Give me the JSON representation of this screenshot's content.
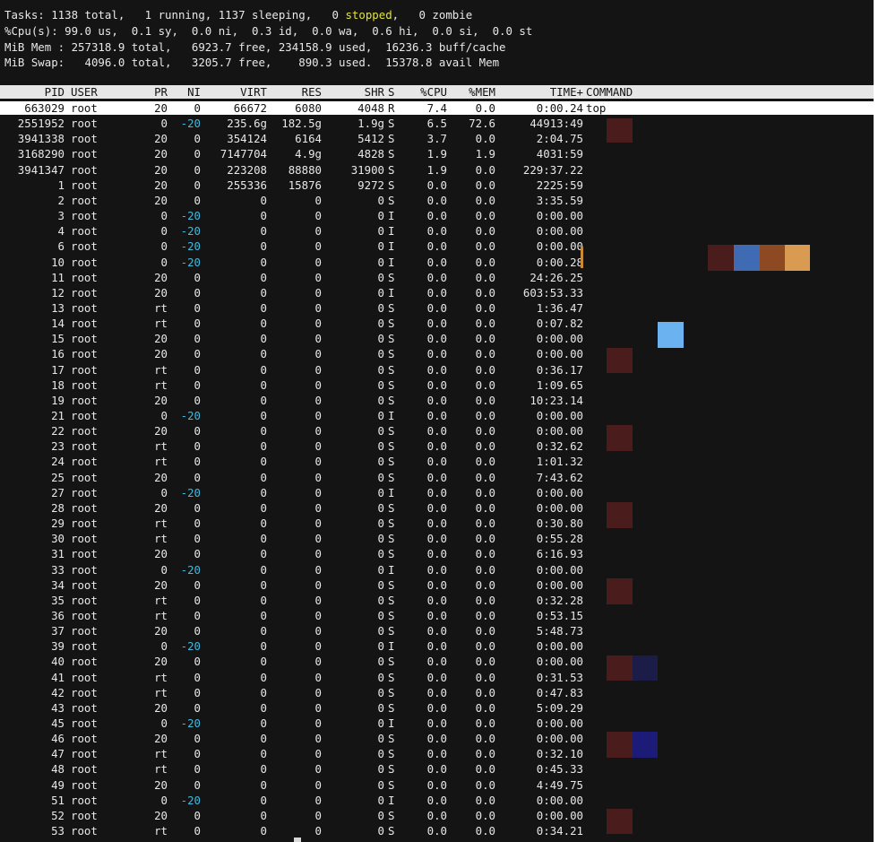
{
  "summary": {
    "tasks_a": "Tasks: 1138 total,   1 running, 1137 sleeping,   0 ",
    "tasks_b": "stopped",
    "tasks_c": ",   0 zombie",
    "cpu": "%Cpu(s): 99.0 us,  0.1 sy,  0.0 ni,  0.3 id,  0.0 wa,  0.6 hi,  0.0 si,  0.0 st",
    "mem": "MiB Mem : 257318.9 total,   6923.7 free, 234158.9 used,  16236.3 buff/cache",
    "swap": "MiB Swap:   4096.0 total,   3205.7 free,    890.3 used.  15378.8 avail Mem"
  },
  "colors": {
    "stopped": "#e3e33a",
    "nice_negative": "#46b6d9",
    "header_bg": "#e6e6e6",
    "terminal_bg": "#141414"
  },
  "columns": [
    "PID",
    "USER",
    "PR",
    "NI",
    "VIRT",
    "RES",
    "SHR",
    "S",
    "%CPU",
    "%MEM",
    "TIME+",
    "COMMAND"
  ],
  "processes": [
    [
      "663029",
      "root",
      "20",
      "0",
      "66672",
      "6080",
      "4048",
      "R",
      "7.4",
      "0.0",
      "0:00.24",
      "top"
    ],
    [
      "2551952",
      "root",
      "0",
      "-20",
      "235.6g",
      "182.5g",
      "1.9g",
      "S",
      "6.5",
      "72.6",
      "44913:49",
      ""
    ],
    [
      "3941338",
      "root",
      "20",
      "0",
      "354124",
      "6164",
      "5412",
      "S",
      "3.7",
      "0.0",
      "2:04.75",
      ""
    ],
    [
      "3168290",
      "root",
      "20",
      "0",
      "7147704",
      "4.9g",
      "4828",
      "S",
      "1.9",
      "1.9",
      "4031:59",
      ""
    ],
    [
      "3941347",
      "root",
      "20",
      "0",
      "223208",
      "88880",
      "31900",
      "S",
      "1.9",
      "0.0",
      "229:37.22",
      ""
    ],
    [
      "1",
      "root",
      "20",
      "0",
      "255336",
      "15876",
      "9272",
      "S",
      "0.0",
      "0.0",
      "2225:59",
      ""
    ],
    [
      "2",
      "root",
      "20",
      "0",
      "0",
      "0",
      "0",
      "S",
      "0.0",
      "0.0",
      "3:35.59",
      ""
    ],
    [
      "3",
      "root",
      "0",
      "-20",
      "0",
      "0",
      "0",
      "I",
      "0.0",
      "0.0",
      "0:00.00",
      ""
    ],
    [
      "4",
      "root",
      "0",
      "-20",
      "0",
      "0",
      "0",
      "I",
      "0.0",
      "0.0",
      "0:00.00",
      ""
    ],
    [
      "6",
      "root",
      "0",
      "-20",
      "0",
      "0",
      "0",
      "I",
      "0.0",
      "0.0",
      "0:00.00",
      ""
    ],
    [
      "10",
      "root",
      "0",
      "-20",
      "0",
      "0",
      "0",
      "I",
      "0.0",
      "0.0",
      "0:00.28",
      ""
    ],
    [
      "11",
      "root",
      "20",
      "0",
      "0",
      "0",
      "0",
      "S",
      "0.0",
      "0.0",
      "24:26.25",
      ""
    ],
    [
      "12",
      "root",
      "20",
      "0",
      "0",
      "0",
      "0",
      "I",
      "0.0",
      "0.0",
      "603:53.33",
      ""
    ],
    [
      "13",
      "root",
      "rt",
      "0",
      "0",
      "0",
      "0",
      "S",
      "0.0",
      "0.0",
      "1:36.47",
      ""
    ],
    [
      "14",
      "root",
      "rt",
      "0",
      "0",
      "0",
      "0",
      "S",
      "0.0",
      "0.0",
      "0:07.82",
      ""
    ],
    [
      "15",
      "root",
      "20",
      "0",
      "0",
      "0",
      "0",
      "S",
      "0.0",
      "0.0",
      "0:00.00",
      ""
    ],
    [
      "16",
      "root",
      "20",
      "0",
      "0",
      "0",
      "0",
      "S",
      "0.0",
      "0.0",
      "0:00.00",
      ""
    ],
    [
      "17",
      "root",
      "rt",
      "0",
      "0",
      "0",
      "0",
      "S",
      "0.0",
      "0.0",
      "0:36.17",
      ""
    ],
    [
      "18",
      "root",
      "rt",
      "0",
      "0",
      "0",
      "0",
      "S",
      "0.0",
      "0.0",
      "1:09.65",
      ""
    ],
    [
      "19",
      "root",
      "20",
      "0",
      "0",
      "0",
      "0",
      "S",
      "0.0",
      "0.0",
      "10:23.14",
      ""
    ],
    [
      "21",
      "root",
      "0",
      "-20",
      "0",
      "0",
      "0",
      "I",
      "0.0",
      "0.0",
      "0:00.00",
      ""
    ],
    [
      "22",
      "root",
      "20",
      "0",
      "0",
      "0",
      "0",
      "S",
      "0.0",
      "0.0",
      "0:00.00",
      ""
    ],
    [
      "23",
      "root",
      "rt",
      "0",
      "0",
      "0",
      "0",
      "S",
      "0.0",
      "0.0",
      "0:32.62",
      ""
    ],
    [
      "24",
      "root",
      "rt",
      "0",
      "0",
      "0",
      "0",
      "S",
      "0.0",
      "0.0",
      "1:01.32",
      ""
    ],
    [
      "25",
      "root",
      "20",
      "0",
      "0",
      "0",
      "0",
      "S",
      "0.0",
      "0.0",
      "7:43.62",
      ""
    ],
    [
      "27",
      "root",
      "0",
      "-20",
      "0",
      "0",
      "0",
      "I",
      "0.0",
      "0.0",
      "0:00.00",
      ""
    ],
    [
      "28",
      "root",
      "20",
      "0",
      "0",
      "0",
      "0",
      "S",
      "0.0",
      "0.0",
      "0:00.00",
      ""
    ],
    [
      "29",
      "root",
      "rt",
      "0",
      "0",
      "0",
      "0",
      "S",
      "0.0",
      "0.0",
      "0:30.80",
      ""
    ],
    [
      "30",
      "root",
      "rt",
      "0",
      "0",
      "0",
      "0",
      "S",
      "0.0",
      "0.0",
      "0:55.28",
      ""
    ],
    [
      "31",
      "root",
      "20",
      "0",
      "0",
      "0",
      "0",
      "S",
      "0.0",
      "0.0",
      "6:16.93",
      ""
    ],
    [
      "33",
      "root",
      "0",
      "-20",
      "0",
      "0",
      "0",
      "I",
      "0.0",
      "0.0",
      "0:00.00",
      ""
    ],
    [
      "34",
      "root",
      "20",
      "0",
      "0",
      "0",
      "0",
      "S",
      "0.0",
      "0.0",
      "0:00.00",
      ""
    ],
    [
      "35",
      "root",
      "rt",
      "0",
      "0",
      "0",
      "0",
      "S",
      "0.0",
      "0.0",
      "0:32.28",
      ""
    ],
    [
      "36",
      "root",
      "rt",
      "0",
      "0",
      "0",
      "0",
      "S",
      "0.0",
      "0.0",
      "0:53.15",
      ""
    ],
    [
      "37",
      "root",
      "20",
      "0",
      "0",
      "0",
      "0",
      "S",
      "0.0",
      "0.0",
      "5:48.73",
      ""
    ],
    [
      "39",
      "root",
      "0",
      "-20",
      "0",
      "0",
      "0",
      "I",
      "0.0",
      "0.0",
      "0:00.00",
      ""
    ],
    [
      "40",
      "root",
      "20",
      "0",
      "0",
      "0",
      "0",
      "S",
      "0.0",
      "0.0",
      "0:00.00",
      ""
    ],
    [
      "41",
      "root",
      "rt",
      "0",
      "0",
      "0",
      "0",
      "S",
      "0.0",
      "0.0",
      "0:31.53",
      ""
    ],
    [
      "42",
      "root",
      "rt",
      "0",
      "0",
      "0",
      "0",
      "S",
      "0.0",
      "0.0",
      "0:47.83",
      ""
    ],
    [
      "43",
      "root",
      "20",
      "0",
      "0",
      "0",
      "0",
      "S",
      "0.0",
      "0.0",
      "5:09.29",
      ""
    ],
    [
      "45",
      "root",
      "0",
      "-20",
      "0",
      "0",
      "0",
      "I",
      "0.0",
      "0.0",
      "0:00.00",
      ""
    ],
    [
      "46",
      "root",
      "20",
      "0",
      "0",
      "0",
      "0",
      "S",
      "0.0",
      "0.0",
      "0:00.00",
      ""
    ],
    [
      "47",
      "root",
      "rt",
      "0",
      "0",
      "0",
      "0",
      "S",
      "0.0",
      "0.0",
      "0:32.10",
      ""
    ],
    [
      "48",
      "root",
      "rt",
      "0",
      "0",
      "0",
      "0",
      "S",
      "0.0",
      "0.0",
      "0:45.33",
      ""
    ],
    [
      "49",
      "root",
      "20",
      "0",
      "0",
      "0",
      "0",
      "S",
      "0.0",
      "0.0",
      "4:49.75",
      ""
    ],
    [
      "51",
      "root",
      "0",
      "-20",
      "0",
      "0",
      "0",
      "I",
      "0.0",
      "0.0",
      "0:00.00",
      ""
    ],
    [
      "52",
      "root",
      "20",
      "0",
      "0",
      "0",
      "0",
      "S",
      "0.0",
      "0.0",
      "0:00.00",
      ""
    ],
    [
      "53",
      "root",
      "rt",
      "0",
      "0",
      "0",
      "0",
      "S",
      "0.0",
      "0.0",
      "0:34.21",
      ""
    ]
  ]
}
